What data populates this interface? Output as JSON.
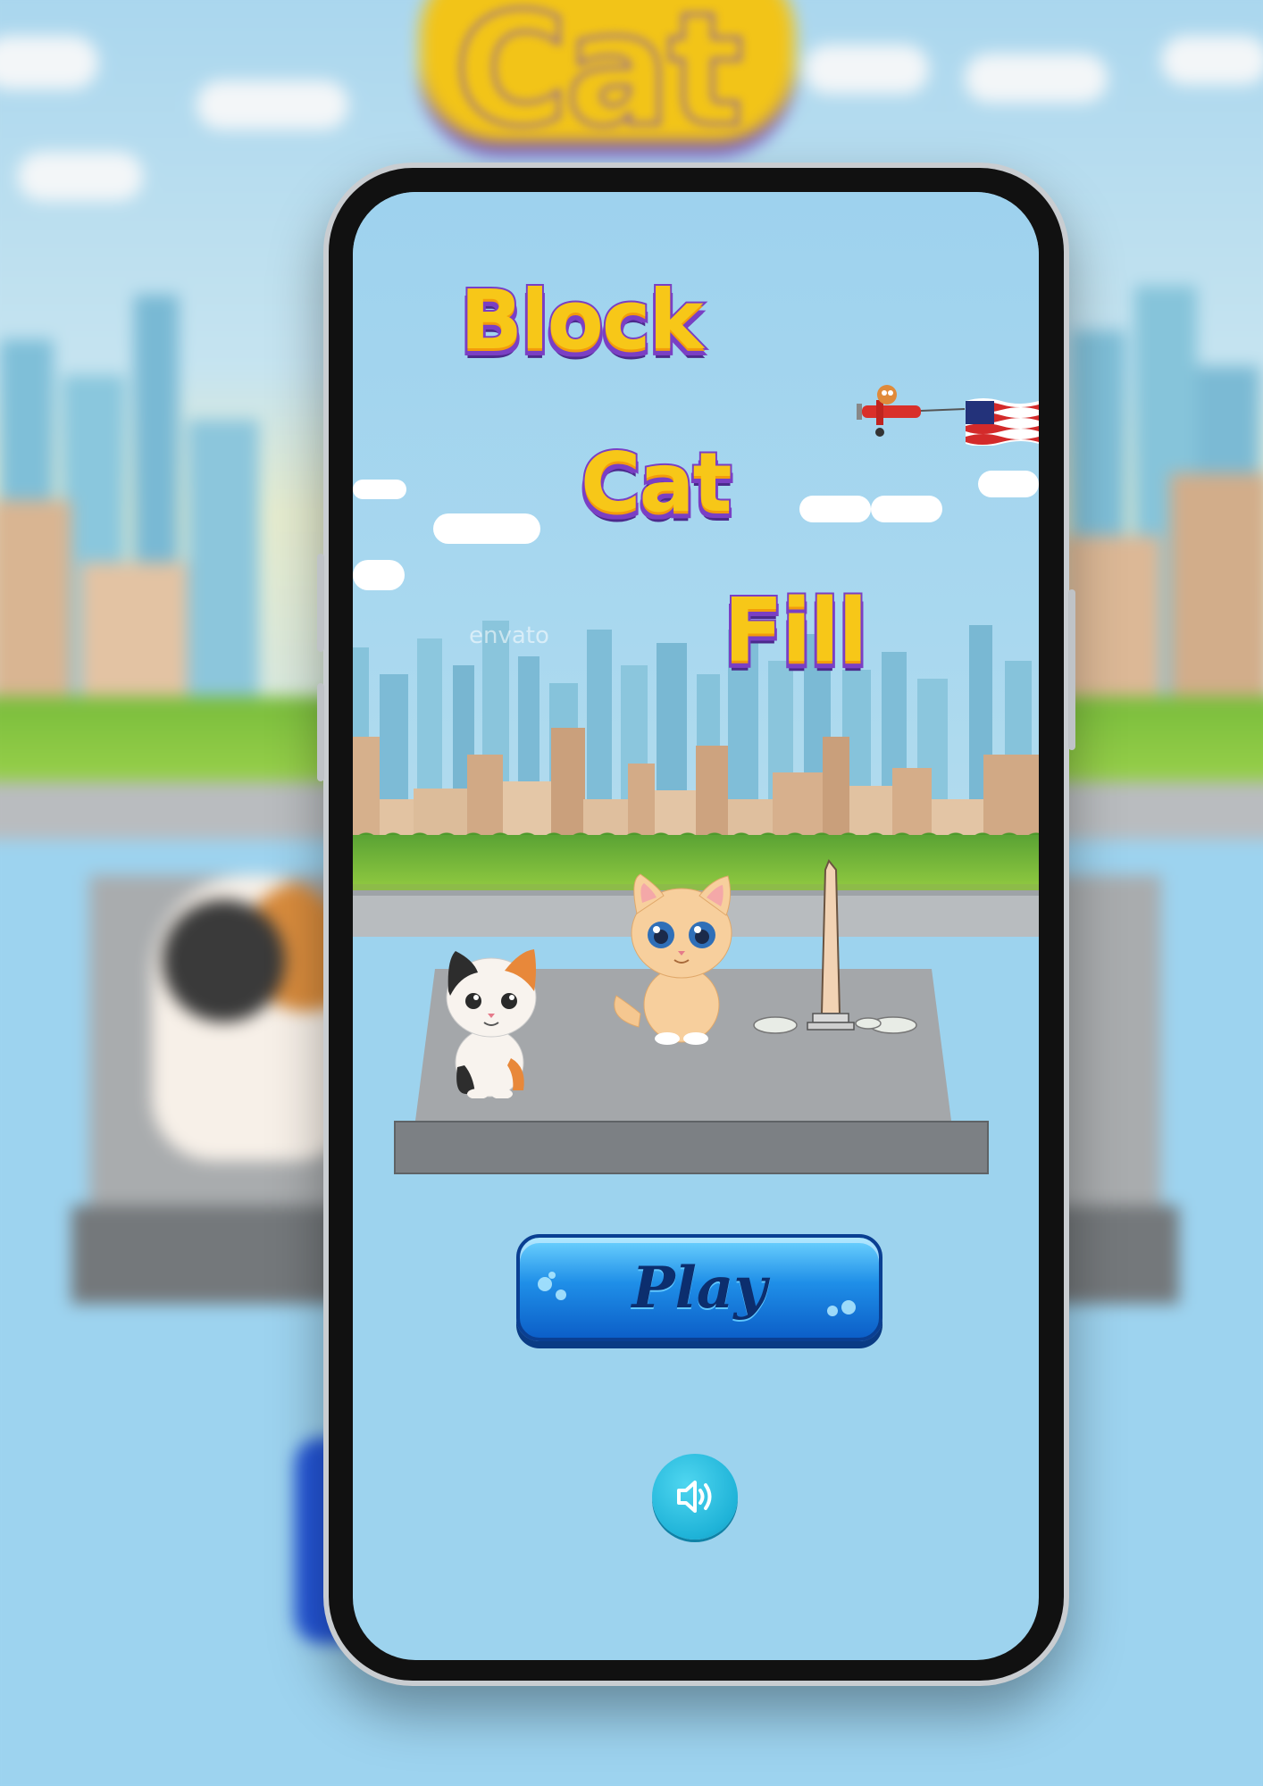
{
  "game": {
    "title_words": [
      "Block",
      "Cat",
      "Fill"
    ],
    "play_label": "Play",
    "watermark": "envato"
  },
  "background": {
    "blurred_title": "Cat"
  },
  "icons": {
    "sound": "speaker-icon",
    "plane": "airplane-banner-icon",
    "flag": "usa-flag-icon"
  },
  "colors": {
    "title_fill": "#f7c718",
    "title_outline": "#7a3fc4",
    "play_button": "#1f8fe8",
    "sound_button": "#1fb3d8",
    "sky": "#9ed2ee"
  }
}
